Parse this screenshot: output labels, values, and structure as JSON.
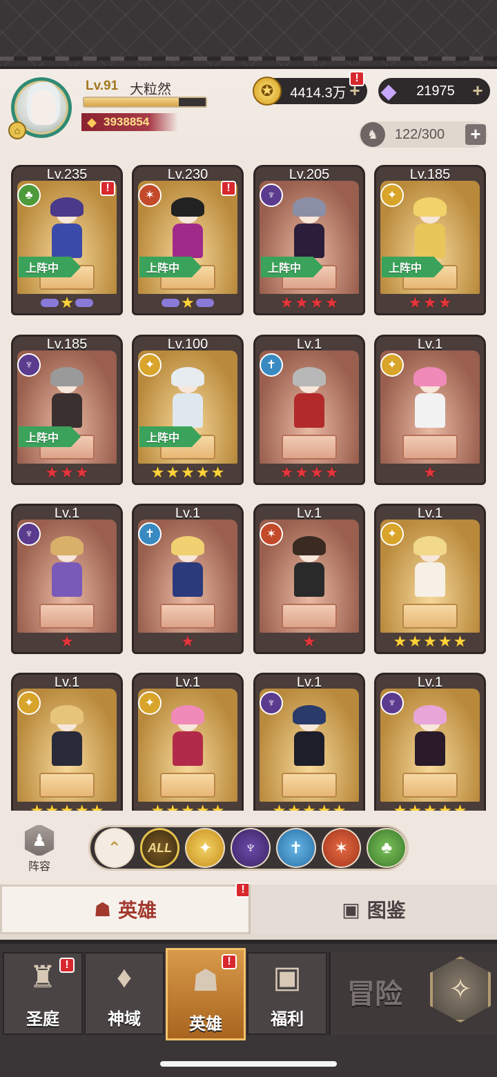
{
  "player": {
    "level": "Lv.91",
    "name": "大粒然",
    "exp_fraction": 0.78,
    "power": "3938854"
  },
  "currencies": {
    "gold": "4414.3万",
    "diamonds": "21975",
    "plus": "+"
  },
  "roster": {
    "count": "122/300",
    "plus": "+"
  },
  "deployed_label": "上阵中",
  "badge_text": "!",
  "colors": {
    "accent_gold": "#d7a54a",
    "alert_red": "#d8282e",
    "deployed_green": "#3aa25a"
  },
  "heroes": [
    {
      "level": "Lv.235",
      "faction": "nature",
      "faction_icon": "tree-icon",
      "alert": true,
      "deployed": true,
      "stars": 1,
      "star_color": "gold",
      "winged": true,
      "frame": "gold",
      "hair": "#4a3a8a",
      "outfit": "#3a4aa8"
    },
    {
      "level": "Lv.230",
      "faction": "beast",
      "faction_icon": "wolf-icon",
      "alert": true,
      "deployed": true,
      "stars": 1,
      "star_color": "gold",
      "winged": true,
      "frame": "gold",
      "hair": "#222",
      "outfit": "#a02a8a"
    },
    {
      "level": "Lv.205",
      "faction": "dark",
      "faction_icon": "demon-icon",
      "alert": false,
      "deployed": true,
      "stars": 4,
      "star_color": "red",
      "winged": false,
      "frame": "brown",
      "hair": "#8a8fa6",
      "outfit": "#2a1e3a"
    },
    {
      "level": "Lv.185",
      "faction": "light",
      "faction_icon": "sun-icon",
      "alert": false,
      "deployed": true,
      "stars": 3,
      "star_color": "red",
      "winged": false,
      "frame": "gold",
      "hair": "#f2d26a",
      "outfit": "#e8c65a"
    },
    {
      "level": "Lv.185",
      "faction": "dark",
      "faction_icon": "demon-icon",
      "alert": false,
      "deployed": true,
      "stars": 3,
      "star_color": "red",
      "winged": false,
      "frame": "brown",
      "hair": "#9a9a9a",
      "outfit": "#3a3030"
    },
    {
      "level": "Lv.100",
      "faction": "light",
      "faction_icon": "sun-icon",
      "alert": false,
      "deployed": true,
      "stars": 5,
      "star_color": "gold",
      "winged": false,
      "frame": "gold",
      "hair": "#e6ecef",
      "outfit": "#dfe8ee"
    },
    {
      "level": "Lv.1",
      "faction": "order",
      "faction_icon": "sword-shield-icon",
      "alert": false,
      "deployed": false,
      "stars": 4,
      "star_color": "red",
      "winged": false,
      "frame": "brown",
      "hair": "#b8b8b8",
      "outfit": "#b22a2a"
    },
    {
      "level": "Lv.1",
      "faction": "light",
      "faction_icon": "sun-icon",
      "alert": false,
      "deployed": false,
      "stars": 1,
      "star_color": "red",
      "winged": false,
      "frame": "brown",
      "hair": "#f08ab8",
      "outfit": "#f2f2f2"
    },
    {
      "level": "Lv.1",
      "faction": "dark",
      "faction_icon": "demon-icon",
      "alert": false,
      "deployed": false,
      "stars": 1,
      "star_color": "red",
      "winged": false,
      "frame": "brown",
      "hair": "#d8b06a",
      "outfit": "#7a5ab8"
    },
    {
      "level": "Lv.1",
      "faction": "order",
      "faction_icon": "sword-shield-icon",
      "alert": false,
      "deployed": false,
      "stars": 1,
      "star_color": "red",
      "winged": false,
      "frame": "brown",
      "hair": "#f0d070",
      "outfit": "#2a3a7a"
    },
    {
      "level": "Lv.1",
      "faction": "beast",
      "faction_icon": "wolf-icon",
      "alert": false,
      "deployed": false,
      "stars": 1,
      "star_color": "red",
      "winged": false,
      "frame": "brown",
      "hair": "#3a2a22",
      "outfit": "#2a2a2a"
    },
    {
      "level": "Lv.1",
      "faction": "light",
      "faction_icon": "sun-icon",
      "alert": false,
      "deployed": false,
      "stars": 5,
      "star_color": "gold",
      "winged": false,
      "frame": "gold",
      "hair": "#f2d88a",
      "outfit": "#f6f0e6"
    },
    {
      "level": "Lv.1",
      "faction": "light",
      "faction_icon": "sun-icon",
      "alert": false,
      "deployed": false,
      "stars": 5,
      "star_color": "gold",
      "winged": false,
      "frame": "gold",
      "hair": "#e6c47a",
      "outfit": "#2a2a3a"
    },
    {
      "level": "Lv.1",
      "faction": "light",
      "faction_icon": "sun-icon",
      "alert": false,
      "deployed": false,
      "stars": 5,
      "star_color": "gold",
      "winged": false,
      "frame": "gold",
      "hair": "#f08ab8",
      "outfit": "#b22a4a"
    },
    {
      "level": "Lv.1",
      "faction": "dark",
      "faction_icon": "demon-icon",
      "alert": false,
      "deployed": false,
      "stars": 5,
      "star_color": "gold",
      "winged": false,
      "frame": "gold",
      "hair": "#2a3a6a",
      "outfit": "#1e1e2a"
    },
    {
      "level": "Lv.1",
      "faction": "dark",
      "faction_icon": "demon-icon",
      "alert": false,
      "deployed": false,
      "stars": 5,
      "star_color": "gold",
      "winged": false,
      "frame": "gold",
      "hair": "#e6a6d8",
      "outfit": "#2a1a2a"
    }
  ],
  "lineup": {
    "label": "阵容"
  },
  "faction_filter": {
    "items": [
      {
        "key": "up",
        "label": "⌃",
        "icon": "chevron-up-icon"
      },
      {
        "key": "all",
        "label": "ALL",
        "icon": "all-icon"
      },
      {
        "key": "light",
        "label": "✦",
        "icon": "sun-icon"
      },
      {
        "key": "dark",
        "label": "♆",
        "icon": "demon-icon"
      },
      {
        "key": "order",
        "label": "✝",
        "icon": "sword-shield-icon"
      },
      {
        "key": "beast",
        "label": "✶",
        "icon": "wolf-icon"
      },
      {
        "key": "nature",
        "label": "♣",
        "icon": "tree-icon"
      }
    ],
    "selected": "all"
  },
  "tabs": {
    "hero": "英雄",
    "codex": "图鉴"
  },
  "nav": {
    "items": [
      {
        "key": "sanctuary",
        "label": "圣庭",
        "icon": "castle-icon",
        "alert": true,
        "active": false,
        "glyph": "♜"
      },
      {
        "key": "divine",
        "label": "神域",
        "icon": "crystal-arch-icon",
        "alert": false,
        "active": false,
        "glyph": "♦"
      },
      {
        "key": "hero",
        "label": "英雄",
        "icon": "helmet-icon",
        "alert": true,
        "active": true,
        "glyph": "☗"
      },
      {
        "key": "welfare",
        "label": "福利",
        "icon": "chest-icon",
        "alert": false,
        "active": false,
        "glyph": "▣"
      }
    ],
    "adventure": "冒险"
  }
}
